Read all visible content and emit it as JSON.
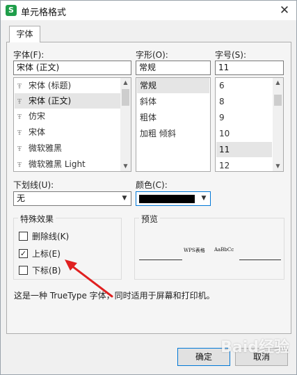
{
  "window": {
    "title": "单元格格式",
    "app_icon_letter": "S"
  },
  "tabs": [
    {
      "label": "字体"
    }
  ],
  "font": {
    "label": "字体(F):",
    "value": "宋体 (正文)",
    "items": [
      "宋体 (标题)",
      "宋体 (正文)",
      "仿宋",
      "宋体",
      "微软雅黑",
      "微软雅黑 Light"
    ],
    "selected_index": 1
  },
  "style": {
    "label": "字形(O):",
    "value": "常规",
    "items": [
      "常规",
      "斜体",
      "粗体",
      "加粗 倾斜"
    ],
    "selected_index": 0
  },
  "size": {
    "label": "字号(S):",
    "value": "11",
    "items": [
      "6",
      "8",
      "9",
      "10",
      "11",
      "12"
    ],
    "selected_index": 4
  },
  "underline": {
    "label": "下划线(U):",
    "value": "无"
  },
  "color": {
    "label": "颜色(C):",
    "value_hex": "#000000"
  },
  "effects": {
    "title": "特殊效果",
    "strikethrough": {
      "label": "删除线(K)",
      "checked": false
    },
    "superscript": {
      "label": "上标(E)",
      "checked": true
    },
    "subscript": {
      "label": "下标(B)",
      "checked": false
    }
  },
  "preview": {
    "title": "预览",
    "sample_main": "WPS表格",
    "sample_sub": "AaBbCc"
  },
  "info_text": "这是一种 TrueType 字体，同时适用于屏幕和打印机。",
  "buttons": {
    "ok": "确定",
    "cancel": "取消"
  },
  "annotation_color": "#e02020",
  "watermark": "Baid经验"
}
